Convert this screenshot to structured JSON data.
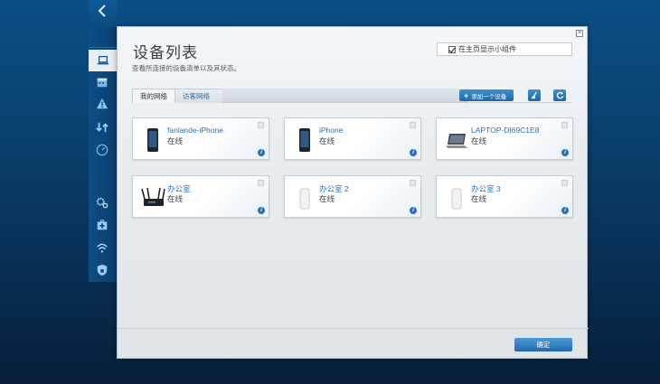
{
  "nav": {
    "back_icon": "chevron-left-icon",
    "items": [
      {
        "icon": "laptop-icon",
        "active": true
      },
      {
        "icon": "calendar-icon"
      },
      {
        "icon": "warning-icon"
      },
      {
        "icon": "transfer-icon"
      },
      {
        "icon": "speedometer-icon"
      },
      {
        "icon": "gears-icon"
      },
      {
        "icon": "medkit-icon"
      },
      {
        "icon": "wifi-icon"
      },
      {
        "icon": "security-shield-icon"
      }
    ]
  },
  "dialog": {
    "title": "设备列表",
    "subtitle": "查看所连接的设备清单以及其状态。",
    "show_widget_label": "在主页显示小组件",
    "show_widget_checked": true,
    "close_icon": "close-icon",
    "tabs": [
      {
        "label": "我的网络",
        "active": true
      },
      {
        "label": "访客网络",
        "active": false
      }
    ],
    "add_device_label": "添加一个设备",
    "ok_label": "确定"
  },
  "devices": [
    {
      "name": "fanlande-iPhone",
      "status": "在线",
      "icon": "smartphone-icon"
    },
    {
      "name": "iPhone",
      "status": "在线",
      "icon": "smartphone-icon"
    },
    {
      "name": "LAPTOP-DI69C1E8",
      "status": "在线",
      "icon": "laptop-icon"
    },
    {
      "name": "办公室",
      "status": "在线",
      "icon": "router-icon"
    },
    {
      "name": "办公室 2",
      "status": "在线",
      "icon": "mesh-node-icon"
    },
    {
      "name": "办公室 3",
      "status": "在线",
      "icon": "mesh-node-icon"
    }
  ],
  "colors": {
    "accent": "#2a6fb1",
    "background": "#0a3b66"
  }
}
